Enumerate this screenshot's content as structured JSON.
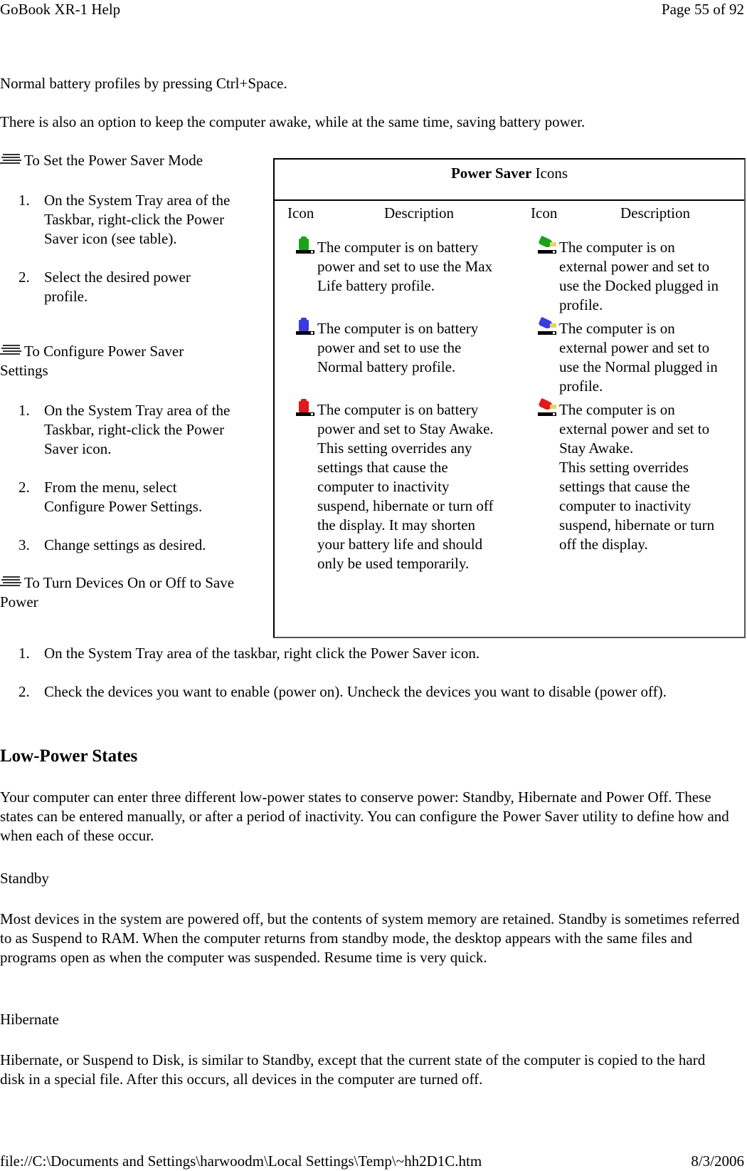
{
  "header": {
    "title": "GoBook XR-1 Help",
    "page": "Page 55 of 92"
  },
  "footer": {
    "path": "file://C:\\Documents and Settings\\harwoodm\\Local Settings\\Temp\\~hh2D1C.htm",
    "date": "8/3/2006"
  },
  "intro": {
    "line1": "Normal battery profiles by pressing Ctrl+Space.",
    "line2": "There is also an option to keep the computer awake, while at the same time, saving battery power."
  },
  "procedures": [
    {
      "icon": "procedure-icon",
      "title": "To Set the Power Saver Mode",
      "steps": [
        {
          "num": "1.",
          "text": "On the System Tray area of the Taskbar, right-click the Power Saver icon (see table)."
        },
        {
          "num": "2.",
          "text": "Select the desired power profile."
        }
      ]
    },
    {
      "icon": "procedure-icon",
      "title": "To Configure Power Saver Settings",
      "steps": [
        {
          "num": "1.",
          "text": "On the System Tray area of the Taskbar, right-click the Power Saver icon."
        },
        {
          "num": "2.",
          "text": "From the menu, select Configure Power Settings."
        },
        {
          "num": "3.",
          "text": "Change settings as desired."
        }
      ]
    },
    {
      "icon": "procedure-icon",
      "title": "To Turn Devices On or Off to Save Power",
      "steps": [
        {
          "num": "1.",
          "text": "On the System Tray area of the taskbar, right click the Power Saver icon."
        },
        {
          "num": "2.",
          "text": "Check the devices you want to enable (power on).  Uncheck the devices you want to disable (power off)."
        }
      ]
    }
  ],
  "icon_table": {
    "caption_bold": "Power Saver",
    "caption_rest": " Icons",
    "headers": [
      "Icon",
      "Description",
      "Icon",
      "Description"
    ],
    "rows": [
      {
        "left": {
          "icon": "battery-green-icon",
          "color": "#1aa31a",
          "text": "The computer is on battery power and set to use the Max Life battery profile."
        },
        "right": {
          "icon": "plug-green-icon",
          "color": "#1aa31a",
          "text": "The computer is on external power and set to use the Docked plugged in profile."
        }
      },
      {
        "left": {
          "icon": "battery-blue-icon",
          "color": "#3a3ae0",
          "text": "The computer is on battery power and set to use the Normal battery profile."
        },
        "right": {
          "icon": "plug-blue-icon",
          "color": "#3a3ae0",
          "text": "The computer is on external power and set to use the Normal plugged in profile."
        }
      },
      {
        "left": {
          "icon": "battery-red-icon",
          "color": "#e01a1a",
          "text": "The computer is on battery power and set to Stay Awake.",
          "note": "This setting overrides any settings that cause the computer to inactivity suspend, hibernate or turn off the display. It may shorten your battery life and should only be used temporarily."
        },
        "right": {
          "icon": "plug-red-icon",
          "color": "#e01a1a",
          "text": "The computer is on external power and set to Stay Awake.",
          "note": "This setting overrides settings that cause the computer to inactivity suspend, hibernate or turn off the display."
        }
      }
    ]
  },
  "low_power": {
    "title": "Low-Power States",
    "intro": "Your computer can enter three different low-power states to conserve power: Standby, Hibernate and Power Off. These states can be entered manually, or after a period of inactivity. You can configure the Power Saver utility to define how and when each of these occur.",
    "standby_title": "Standby",
    "standby_text": "Most devices in the system are powered off, but the contents of system memory are retained. Standby is sometimes referred to as Suspend to RAM. When the computer returns from standby mode, the desktop appears with the same files and programs open as when the computer was suspended. Resume time is very quick.",
    "hibernate_title": "Hibernate",
    "hibernate_text": "Hibernate, or Suspend to Disk, is similar to Standby, except that the current state of the computer is copied to the hard disk in a special file. After this occurs, all devices in the computer are turned off."
  }
}
